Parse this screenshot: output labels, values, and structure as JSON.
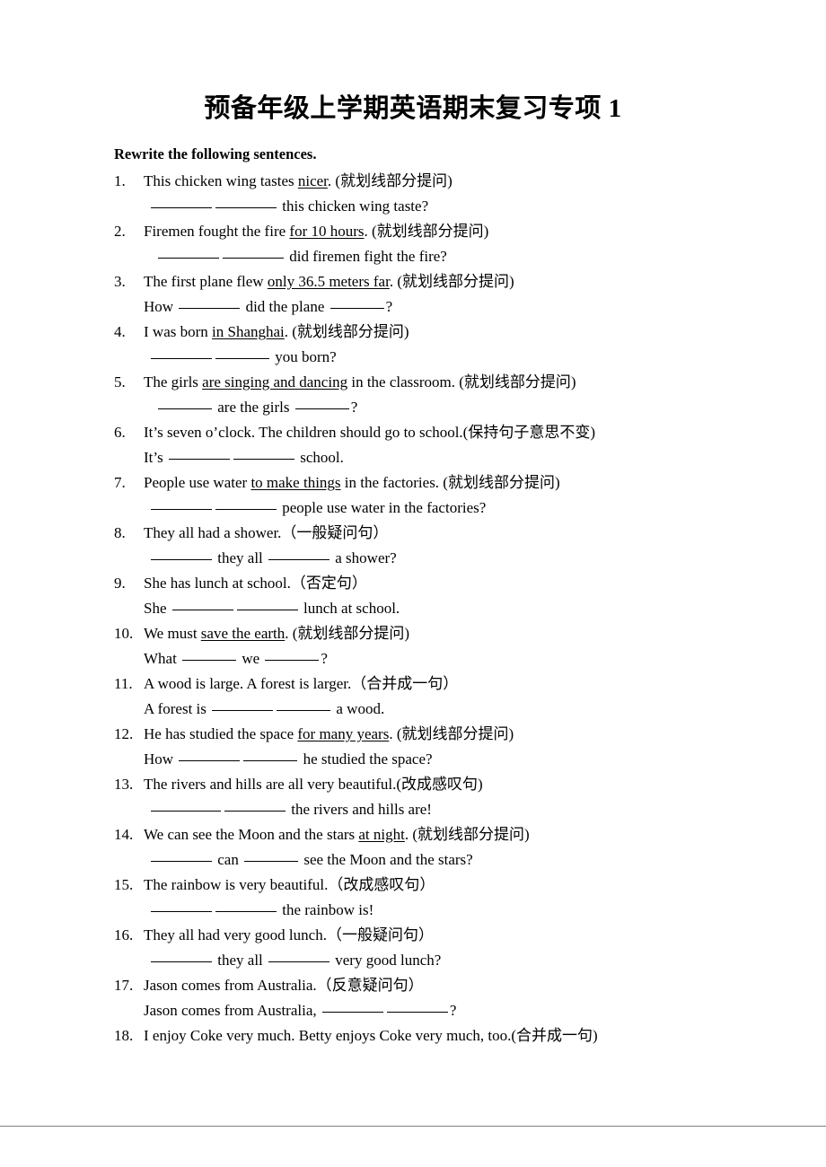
{
  "document": {
    "title": "预备年级上学期英语期末复习专项 1",
    "section_heading": "Rewrite the following sentences."
  },
  "questions": [
    {
      "number": "1.",
      "prompt_pre": "This chicken wing tastes ",
      "prompt_underlined": "nicer",
      "prompt_post": ". (就划线部分提问)",
      "answer_pre": "",
      "answer_post": " this chicken wing taste?"
    },
    {
      "number": "2.",
      "prompt_pre": "Firemen fought the fire ",
      "prompt_underlined": "for 10 hours",
      "prompt_post": ". (就划线部分提问)",
      "answer_pre": "",
      "answer_post": " did firemen fight the fire?"
    },
    {
      "number": "3.",
      "prompt_pre": "The first plane flew ",
      "prompt_underlined": "only 36.5 meters far",
      "prompt_post": ". (就划线部分提问)",
      "answer_pre": "How ",
      "answer_mid": " did the plane ",
      "answer_post": "?"
    },
    {
      "number": "4.",
      "prompt_pre": "I was born ",
      "prompt_underlined": "in Shanghai",
      "prompt_post": ". (就划线部分提问)",
      "answer_pre": "",
      "answer_post": " you born?"
    },
    {
      "number": "5.",
      "prompt_pre": "The girls ",
      "prompt_underlined": "are singing and dancing",
      "prompt_post": " in the classroom. (就划线部分提问)",
      "answer_pre": "",
      "answer_mid": " are the girls ",
      "answer_post": "?"
    },
    {
      "number": "6.",
      "prompt_pre": "It’s seven o’clock. The children should go to school.(保持句子意思不变)",
      "prompt_underlined": "",
      "prompt_post": "",
      "answer_pre": "It’s ",
      "answer_post": " school."
    },
    {
      "number": "7.",
      "prompt_pre": "People use water ",
      "prompt_underlined": "to make things",
      "prompt_post": " in the factories. (就划线部分提问)",
      "answer_pre": "",
      "answer_post": " people use water in the factories?"
    },
    {
      "number": "8.",
      "prompt_pre": "They all had a shower.（一般疑问句）",
      "prompt_underlined": "",
      "prompt_post": "",
      "answer_pre": "",
      "answer_mid": " they all ",
      "answer_post": " a shower?"
    },
    {
      "number": "9.",
      "prompt_pre": "She has lunch at school.（否定句）",
      "prompt_underlined": "",
      "prompt_post": "",
      "answer_pre": "She ",
      "answer_post": " lunch at school."
    },
    {
      "number": "10.",
      "prompt_pre": "We must ",
      "prompt_underlined": "save the earth",
      "prompt_post": ". (就划线部分提问)",
      "answer_pre": "What ",
      "answer_mid": " we ",
      "answer_post": "?"
    },
    {
      "number": "11.",
      "prompt_pre": "A wood is large. A forest is larger.（合并成一句）",
      "prompt_underlined": "",
      "prompt_post": "",
      "answer_pre": "A forest is ",
      "answer_post": " a wood."
    },
    {
      "number": "12.",
      "prompt_pre": "He has studied the space ",
      "prompt_underlined": "for many years",
      "prompt_post": ". (就划线部分提问)",
      "answer_pre": "How ",
      "answer_post": " he studied the space?"
    },
    {
      "number": "13.",
      "prompt_pre": "The rivers and hills are all very beautiful.(改成感叹句)",
      "prompt_underlined": "",
      "prompt_post": "",
      "answer_pre": "",
      "answer_post": " the rivers and hills are!"
    },
    {
      "number": "14.",
      "prompt_pre": "We can see the Moon and the stars ",
      "prompt_underlined": "at night",
      "prompt_post": ". (就划线部分提问)",
      "answer_pre": "",
      "answer_mid": " can ",
      "answer_post": " see the Moon and the stars?"
    },
    {
      "number": "15.",
      "prompt_pre": "The rainbow is very beautiful.（改成感叹句）",
      "prompt_underlined": "",
      "prompt_post": "",
      "answer_pre": "",
      "answer_post": " the rainbow is!"
    },
    {
      "number": "16.",
      "prompt_pre": "They all had very good lunch.（一般疑问句）",
      "prompt_underlined": "",
      "prompt_post": "",
      "answer_pre": "",
      "answer_mid": " they all ",
      "answer_post": " very good lunch?"
    },
    {
      "number": "17.",
      "prompt_pre": "Jason comes from Australia.（反意疑问句）",
      "prompt_underlined": "",
      "prompt_post": "",
      "answer_pre": "Jason comes from Australia, ",
      "answer_post": "?"
    },
    {
      "number": "18.",
      "prompt_pre": "I enjoy Coke very much. Betty enjoys Coke very much, too.(合并成一句)",
      "prompt_underlined": "",
      "prompt_post": "",
      "answer_pre": "",
      "answer_post": ""
    }
  ]
}
